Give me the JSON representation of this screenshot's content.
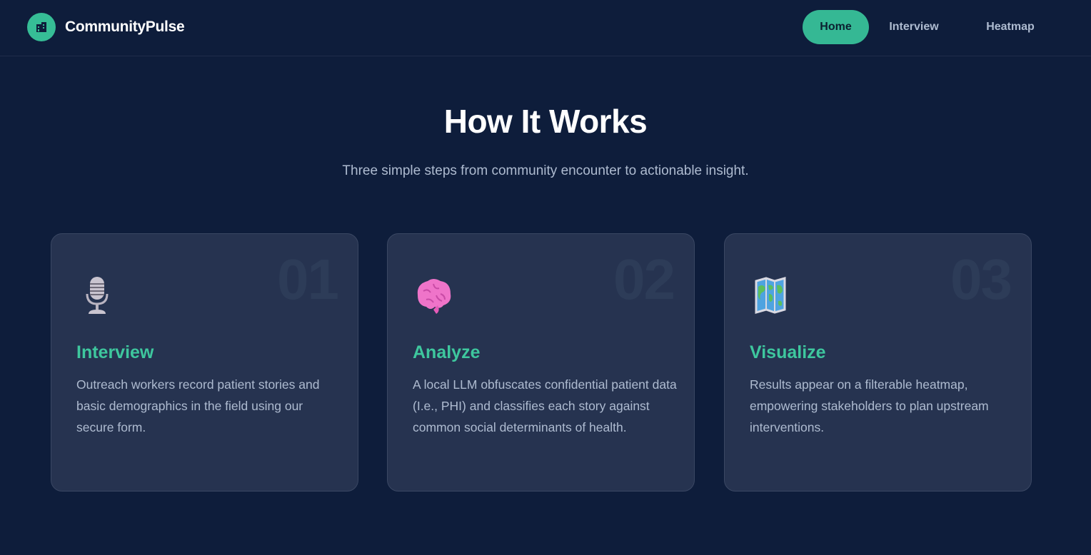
{
  "header": {
    "brand": "CommunityPulse",
    "nav": [
      {
        "label": "Home",
        "active": true
      },
      {
        "label": "Interview",
        "active": false
      },
      {
        "label": "Heatmap",
        "active": false
      }
    ]
  },
  "main": {
    "title": "How It Works",
    "subtitle": "Three simple steps from community encounter to actionable insight.",
    "steps": [
      {
        "number": "01",
        "icon": "microphone-icon",
        "title": "Interview",
        "description": "Outreach workers record patient stories and basic demographics in the field using our secure form."
      },
      {
        "number": "02",
        "icon": "brain-icon",
        "title": "Analyze",
        "description": "A local LLM obfuscates confidential patient data (I.e., PHI) and classifies each story against common social determinants of health."
      },
      {
        "number": "03",
        "icon": "world-map-icon",
        "title": "Visualize",
        "description": "Results appear on a filterable heatmap, empowering stakeholders to plan upstream interventions."
      }
    ]
  },
  "colors": {
    "background": "#0e1d3b",
    "card": "#263350",
    "accent": "#36bd96",
    "title_accent": "#3ec79e",
    "muted_text": "#aebbd0"
  }
}
